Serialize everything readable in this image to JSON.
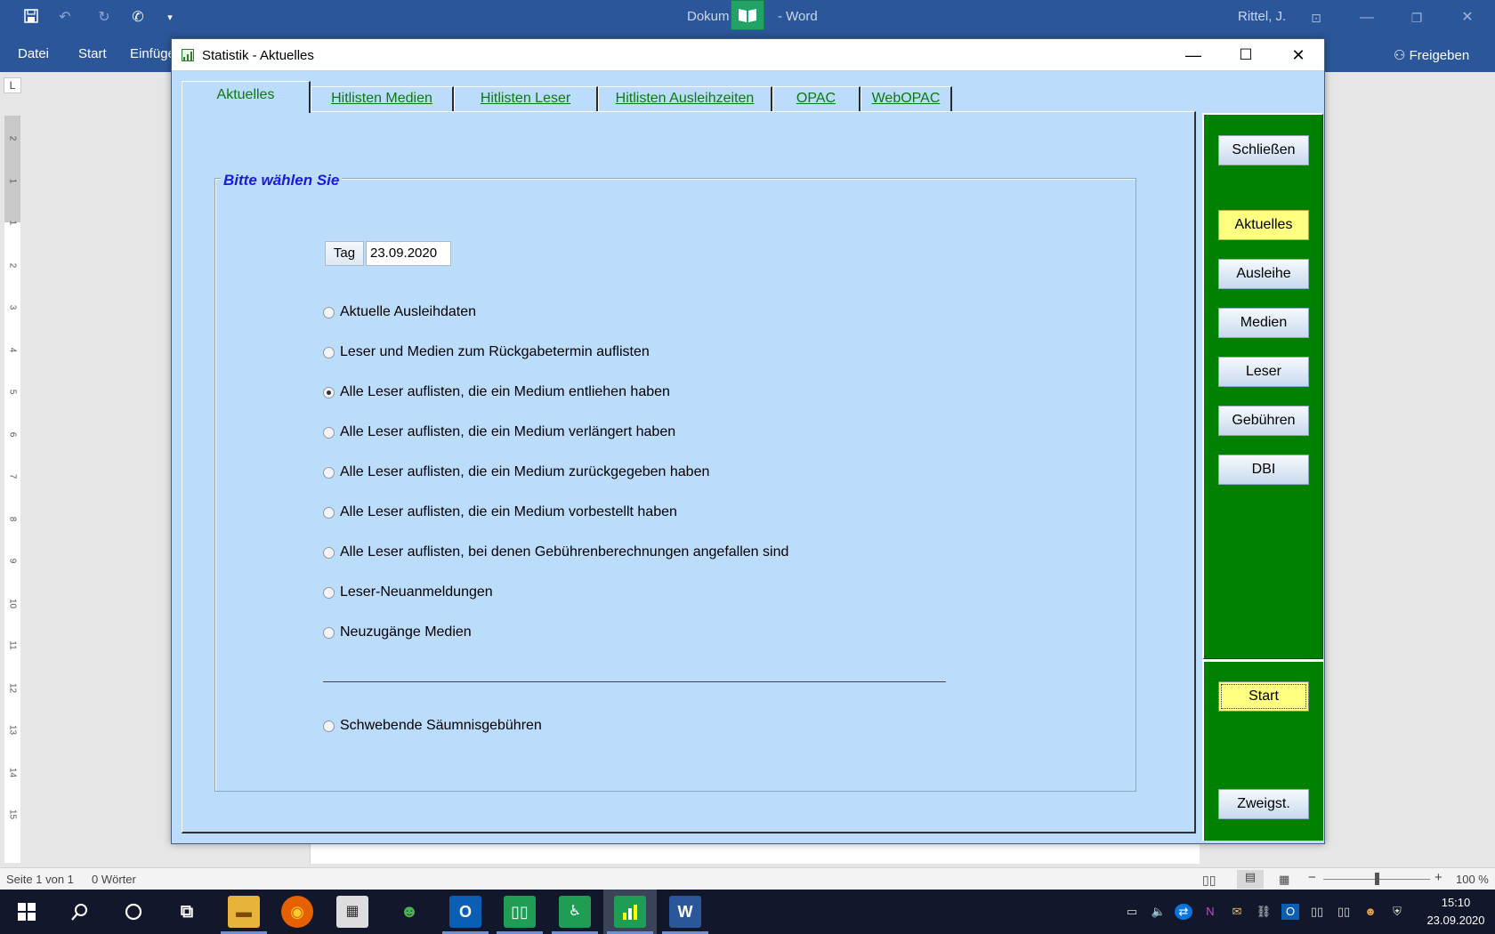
{
  "word": {
    "title_left": "Dokum",
    "title_right": "- Word",
    "user": "Rittel, J.",
    "ribbon_tabs": [
      "Datei",
      "Start",
      "Einfüge"
    ],
    "share_label": "Freigeben"
  },
  "ruler": {
    "corner": "L",
    "numbers": [
      "2",
      "1",
      "1",
      "2",
      "3",
      "4",
      "5",
      "6",
      "7",
      "8",
      "9",
      "10",
      "11",
      "12",
      "13",
      "14",
      "15"
    ]
  },
  "status": {
    "page": "Seite 1 von 1",
    "words": "0 Wörter",
    "zoom": "100 %"
  },
  "clock": {
    "time": "15:10",
    "date": "23.09.2020"
  },
  "dialog": {
    "title": "Statistik - Aktuelles",
    "tabs": [
      {
        "label": "Aktuelles",
        "active": true
      },
      {
        "label": "Hitlisten Medien",
        "active": false
      },
      {
        "label": "Hitlisten Leser",
        "active": false
      },
      {
        "label": "Hitlisten Ausleihzeiten",
        "active": false
      },
      {
        "label": "OPAC",
        "active": false
      },
      {
        "label": "WebOPAC",
        "active": false
      }
    ],
    "group_title": "Bitte wählen Sie",
    "tag_button": "Tag",
    "date_value": "23.09.2020",
    "options": [
      {
        "label": "Aktuelle Ausleihdaten",
        "checked": false
      },
      {
        "label": "Leser und Medien zum Rückgabetermin auflisten",
        "checked": false
      },
      {
        "label": "Alle Leser auflisten, die ein Medium entliehen haben",
        "checked": true
      },
      {
        "label": "Alle Leser auflisten, die ein Medium verlängert haben",
        "checked": false
      },
      {
        "label": "Alle Leser auflisten, die ein Medium zurückgegeben haben",
        "checked": false
      },
      {
        "label": "Alle Leser auflisten, die ein Medium vorbestellt haben",
        "checked": false
      },
      {
        "label": "Alle Leser auflisten, bei denen Gebührenberechnungen angefallen sind",
        "checked": false
      },
      {
        "label": "Leser-Neuanmeldungen",
        "checked": false
      },
      {
        "label": "Neuzugänge Medien",
        "checked": false
      }
    ],
    "extra_option": {
      "label": "Schwebende Säumnisgebühren",
      "checked": false
    },
    "side_buttons": {
      "close": "Schließen",
      "aktuelles": "Aktuelles",
      "ausleihe": "Ausleihe",
      "medien": "Medien",
      "leser": "Leser",
      "gebuehren": "Gebühren",
      "dbi": "DBI",
      "start": "Start",
      "zweigst": "Zweigst."
    }
  },
  "colors": {
    "word_blue": "#2b579a",
    "dialog_bg": "#bcdcfc",
    "panel_green": "#008000",
    "highlight_yellow": "#ffff80",
    "tab_text_green": "#0a7a10",
    "group_title_blue": "#1a1adc"
  }
}
